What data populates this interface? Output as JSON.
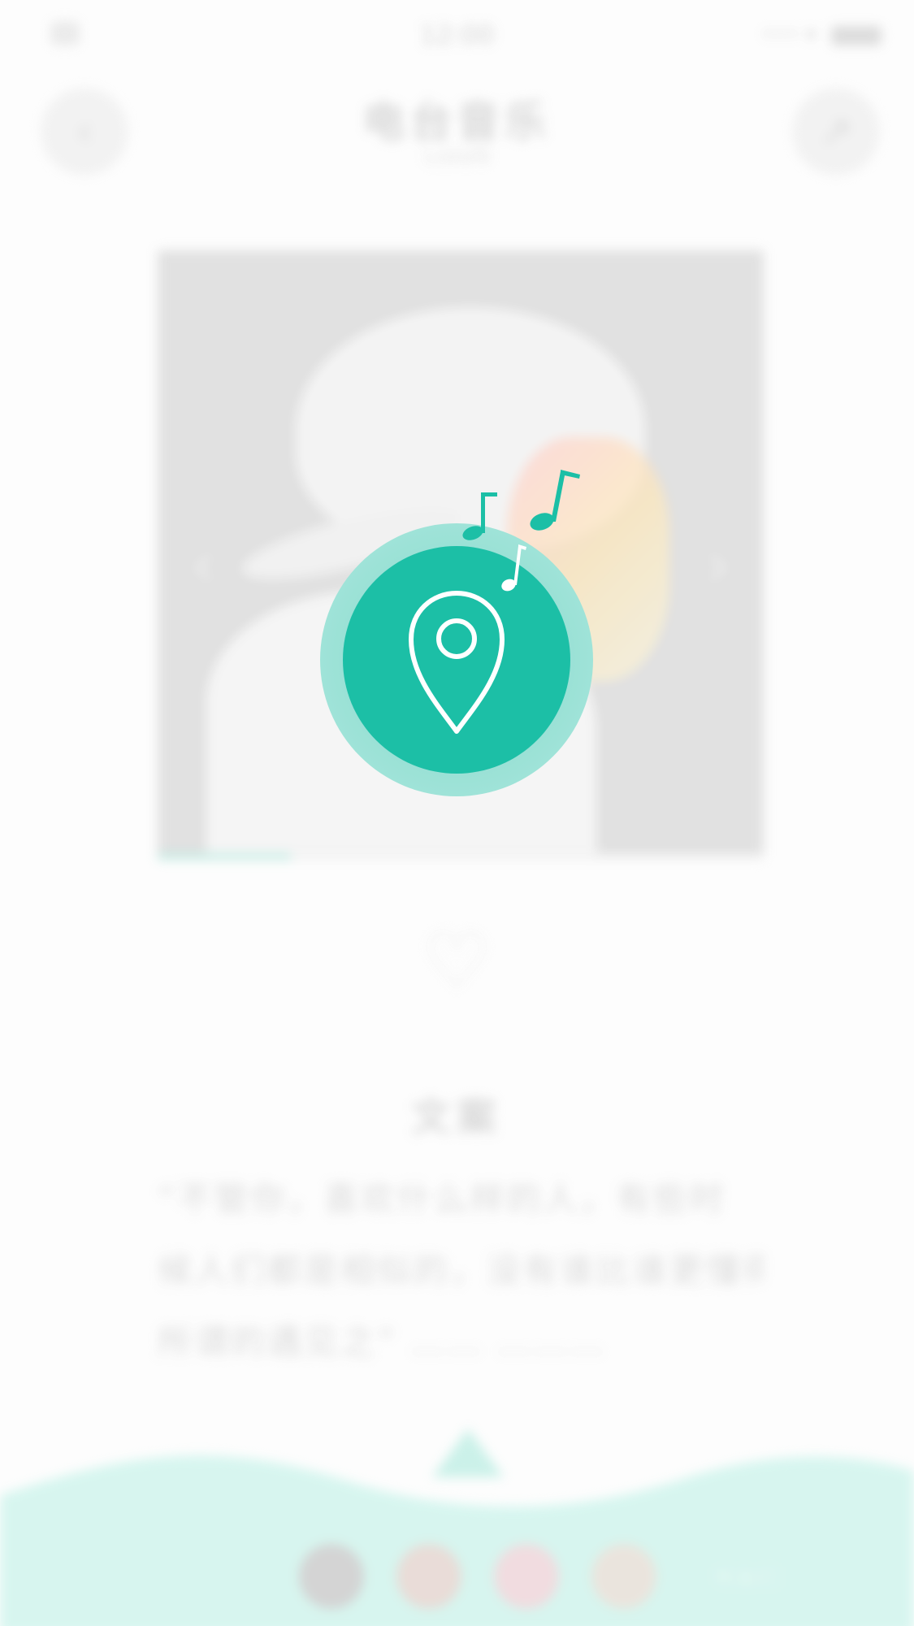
{
  "colors": {
    "accent": "#1cbfa6",
    "accent_light": "#9fe3d8",
    "wave": "#d3f5ee",
    "background": "#fdfdfd"
  },
  "statusbar": {
    "time": "12:00",
    "right_text": "••• ▾"
  },
  "header": {
    "title": "电台音乐",
    "subtitle": "ListeN",
    "back_icon": "back-icon",
    "share_icon": "share-icon"
  },
  "player": {
    "progress_fraction": 0.22,
    "favorite_icon": "heart-icon"
  },
  "story": {
    "title": "文案",
    "lines": [
      "“不管你，喜欢什么样的人，有些时",
      "候人们都是相似的，没有谁比谁更懂得。",
      "所谓的遇见之” …… ………"
    ]
  },
  "footer": {
    "expand_icon": "chevron-up-icon",
    "label": "听友们"
  },
  "overlay": {
    "icon": "location-pin-icon",
    "notes": [
      "music-note-icon",
      "music-note-icon",
      "music-note-icon"
    ]
  }
}
